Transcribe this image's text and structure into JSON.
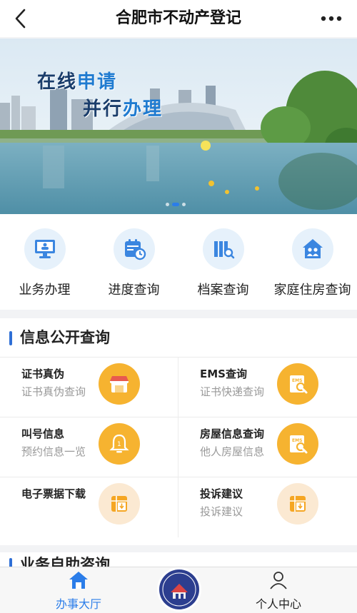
{
  "header": {
    "title": "合肥市不动产登记",
    "back_icon": "chevron-left-icon",
    "more_icon": "more-dots-icon"
  },
  "banner": {
    "line1_a": "在线",
    "line1_b": "申请",
    "line2_a": "并行",
    "line2_b": "办理",
    "dots": 3,
    "active_dot": 2
  },
  "quick": [
    {
      "label": "业务办理",
      "icon": "computer-service-icon"
    },
    {
      "label": "进度查询",
      "icon": "calendar-clock-icon"
    },
    {
      "label": "档案查询",
      "icon": "archive-search-icon"
    },
    {
      "label": "家庭住房查询",
      "icon": "house-family-icon"
    }
  ],
  "info": {
    "title": "信息公开查询",
    "items": [
      {
        "title": "证书真伪",
        "subtitle": "证书真伪查询",
        "icon": "shop-icon"
      },
      {
        "title": "EMS查询",
        "subtitle": "证书快递查询",
        "icon": "ems-search-icon"
      },
      {
        "title": "叫号信息",
        "subtitle": "预约信息一览",
        "icon": "bell-number-icon"
      },
      {
        "title": "房屋信息查询",
        "subtitle": "他人房屋信息",
        "icon": "ems-search-icon"
      },
      {
        "title": "电子票据下载",
        "subtitle": "",
        "icon": "download-grid-icon"
      },
      {
        "title": "投诉建议",
        "subtitle": "投诉建议",
        "icon": "download-grid-icon"
      }
    ]
  },
  "next_section": {
    "title": "业务自助咨询"
  },
  "tabbar": {
    "home_label": "办事大厅",
    "profile_label": "个人中心",
    "emblem_text_top": "不动产登记",
    "emblem_text_bottom": "Real Estate Registration",
    "active_color": "#2b7de9"
  },
  "colors": {
    "accent": "#2b7de9",
    "icon_orange": "#f5a623",
    "icon_light": "#fbe9d2"
  }
}
